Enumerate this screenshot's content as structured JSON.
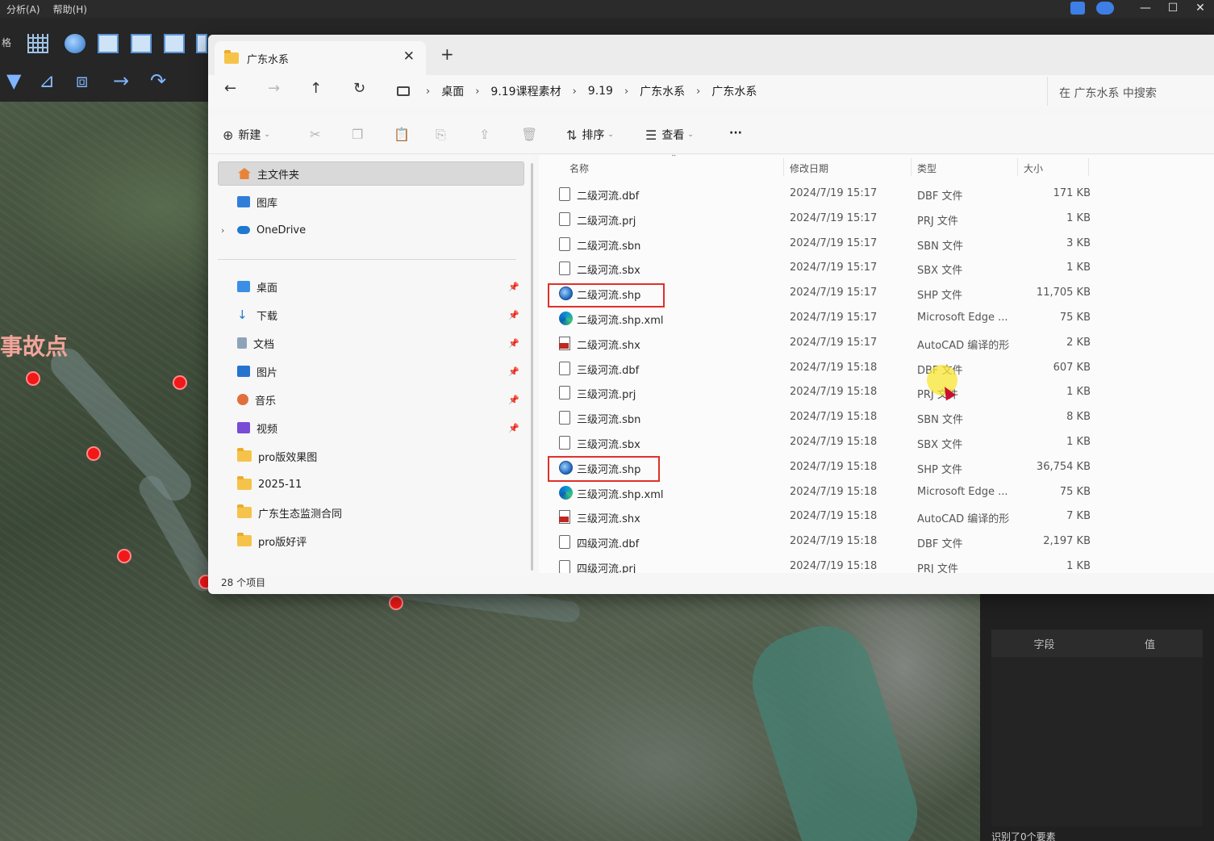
{
  "gis": {
    "menu": [
      "分析(A)",
      "帮助(H)"
    ],
    "toolbar_side_text": "格",
    "window_controls": [
      "—",
      "☐",
      "✕"
    ],
    "map_label": "事故点",
    "attr_panel": {
      "col_field": "字段",
      "col_value": "值",
      "footer": "识别了0个要素"
    }
  },
  "explorer": {
    "tab_title": "广东水系",
    "tab_close": "✕",
    "new_tab": "+",
    "nav_buttons": {
      "back": "←",
      "forward": "→",
      "up": "↑",
      "refresh": "↻"
    },
    "breadcrumb": [
      "桌面",
      "9.19课程素材",
      "9.19",
      "广东水系",
      "广东水系"
    ],
    "breadcrumb_sep": "›",
    "search_placeholder": "在 广东水系 中搜索",
    "commands": {
      "new": "新建",
      "sort": "排序",
      "view": "查看",
      "more": "···"
    },
    "nav_items": [
      {
        "label": "主文件夹",
        "icon": "home-icon"
      },
      {
        "label": "图库",
        "icon": "gallery-icon"
      },
      {
        "label": "OneDrive",
        "icon": "cloud-icon"
      },
      {
        "label": "桌面",
        "icon": "desktop-icon"
      },
      {
        "label": "下载",
        "icon": "download-icon"
      },
      {
        "label": "文档",
        "icon": "document-icon"
      },
      {
        "label": "图片",
        "icon": "pictures-icon"
      },
      {
        "label": "音乐",
        "icon": "music-icon"
      },
      {
        "label": "视频",
        "icon": "video-icon"
      },
      {
        "label": "pro版效果图",
        "icon": "folder-icon"
      },
      {
        "label": "2025-11",
        "icon": "folder-icon"
      },
      {
        "label": "广东生态监测合同",
        "icon": "folder-icon"
      },
      {
        "label": "pro版好评",
        "icon": "folder-icon"
      }
    ],
    "columns": {
      "name": "名称",
      "date": "修改日期",
      "type": "类型",
      "size": "大小"
    },
    "files": [
      {
        "name": "二级河流.dbf",
        "date": "2024/7/19 15:17",
        "type": "DBF 文件",
        "size": "171 KB",
        "icon": "file-icon"
      },
      {
        "name": "二级河流.prj",
        "date": "2024/7/19 15:17",
        "type": "PRJ 文件",
        "size": "1 KB",
        "icon": "file-icon"
      },
      {
        "name": "二级河流.sbn",
        "date": "2024/7/19 15:17",
        "type": "SBN 文件",
        "size": "3 KB",
        "icon": "file-icon"
      },
      {
        "name": "二级河流.sbx",
        "date": "2024/7/19 15:17",
        "type": "SBX 文件",
        "size": "1 KB",
        "icon": "file-icon"
      },
      {
        "name": "二级河流.shp",
        "date": "2024/7/19 15:17",
        "type": "SHP 文件",
        "size": "11,705 KB",
        "icon": "globe-icon"
      },
      {
        "name": "二级河流.shp.xml",
        "date": "2024/7/19 15:17",
        "type": "Microsoft Edge ...",
        "size": "75 KB",
        "icon": "edge-icon"
      },
      {
        "name": "二级河流.shx",
        "date": "2024/7/19 15:17",
        "type": "AutoCAD 编译的形",
        "size": "2 KB",
        "icon": "autocad-icon"
      },
      {
        "name": "三级河流.dbf",
        "date": "2024/7/19 15:18",
        "type": "DBF 文件",
        "size": "607 KB",
        "icon": "file-icon"
      },
      {
        "name": "三级河流.prj",
        "date": "2024/7/19 15:18",
        "type": "PRJ 文件",
        "size": "1 KB",
        "icon": "file-icon"
      },
      {
        "name": "三级河流.sbn",
        "date": "2024/7/19 15:18",
        "type": "SBN 文件",
        "size": "8 KB",
        "icon": "file-icon"
      },
      {
        "name": "三级河流.sbx",
        "date": "2024/7/19 15:18",
        "type": "SBX 文件",
        "size": "1 KB",
        "icon": "file-icon"
      },
      {
        "name": "三级河流.shp",
        "date": "2024/7/19 15:18",
        "type": "SHP 文件",
        "size": "36,754 KB",
        "icon": "globe-icon"
      },
      {
        "name": "三级河流.shp.xml",
        "date": "2024/7/19 15:18",
        "type": "Microsoft Edge ...",
        "size": "75 KB",
        "icon": "edge-icon"
      },
      {
        "name": "三级河流.shx",
        "date": "2024/7/19 15:18",
        "type": "AutoCAD 编译的形",
        "size": "7 KB",
        "icon": "autocad-icon"
      },
      {
        "name": "四级河流.dbf",
        "date": "2024/7/19 15:18",
        "type": "DBF 文件",
        "size": "2,197 KB",
        "icon": "file-icon"
      },
      {
        "name": "四级河流.prj",
        "date": "2024/7/19 15:18",
        "type": "PRJ 文件",
        "size": "1 KB",
        "icon": "file-icon"
      }
    ],
    "status": "28 个项目"
  },
  "colors": {
    "highlight": "#e0302a",
    "map_point": "#f01818",
    "folder": "#f6c34a"
  }
}
